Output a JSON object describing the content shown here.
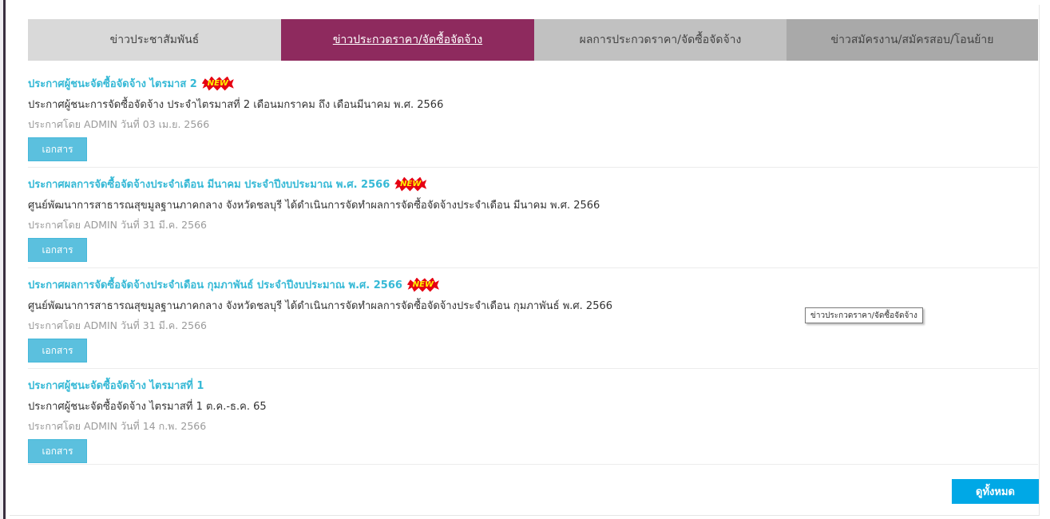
{
  "tabs": [
    {
      "label": "ข่าวประชาสัมพันธ์"
    },
    {
      "label": "ข่าวประกวดราคา/จัดซื้อจัดจ้าง"
    },
    {
      "label": "ผลการประกวดราคา/จัดซื้อจัดจ้าง"
    },
    {
      "label": "ข่าวสมัครงาน/สมัครสอบ/โอนย้าย"
    }
  ],
  "new_badge": "NEW",
  "items": [
    {
      "title": "ประกาศผู้ชนะจัดซื้อจัดจ้าง ไตรมาส 2",
      "description": "ประกาศผู้ชนะการจัดซื้อจัดจ้าง ประจำไตรมาสที่ 2 เดือนมกราคม ถึง เดือนมีนาคม พ.ศ. 2566",
      "meta": "ประกาศโดย ADMIN วันที่ 03 เม.ย. 2566",
      "button": "เอกสาร"
    },
    {
      "title": "ประกาศผลการจัดซื้อจัดจ้างประจำเดือน มีนาคม ประจำปีงบประมาณ พ.ศ. 2566",
      "description": "ศูนย์พัฒนาการสาธารณสุขมูลฐานภาคกลาง จังหวัดชลบุรี ได้ดำเนินการจัดทำผลการจัดซื้อจัดจ้างประจำเดือน มีนาคม พ.ศ. 2566",
      "meta": "ประกาศโดย ADMIN วันที่ 31 มี.ค. 2566",
      "button": "เอกสาร"
    },
    {
      "title": "ประกาศผลการจัดซื้อจัดจ้างประจำเดือน กุมภาพันธ์ ประจำปีงบประมาณ พ.ศ. 2566",
      "description": "ศูนย์พัฒนาการสาธารณสุขมูลฐานภาคกลาง จังหวัดชลบุรี ได้ดำเนินการจัดทำผลการจัดซื้อจัดจ้างประจำเดือน กุมภาพันธ์ พ.ศ. 2566",
      "meta": "ประกาศโดย ADMIN วันที่ 31 มี.ค. 2566",
      "button": "เอกสาร"
    },
    {
      "title": "ประกาศผู้ชนะจัดซื้อจัดจ้าง ไตรมาสที่ 1",
      "description": "ประกาศผู้ชนะจัดซื้อจัดจ้าง ไตรมาสที่ 1 ต.ค.-ธ.ค. 65",
      "meta": "ประกาศโดย ADMIN วันที่ 14 ก.พ. 2566",
      "button": "เอกสาร"
    }
  ],
  "view_all": "ดูทั้งหมด",
  "tooltip": "ข่าวประกวดราคา/จัดซื้อจัดจ้าง",
  "colors": {
    "active_tab": "#8e2a5e",
    "title_link": "#36b9d6",
    "doc_button": "#5bc0de",
    "view_all_button": "#00a8e6"
  }
}
